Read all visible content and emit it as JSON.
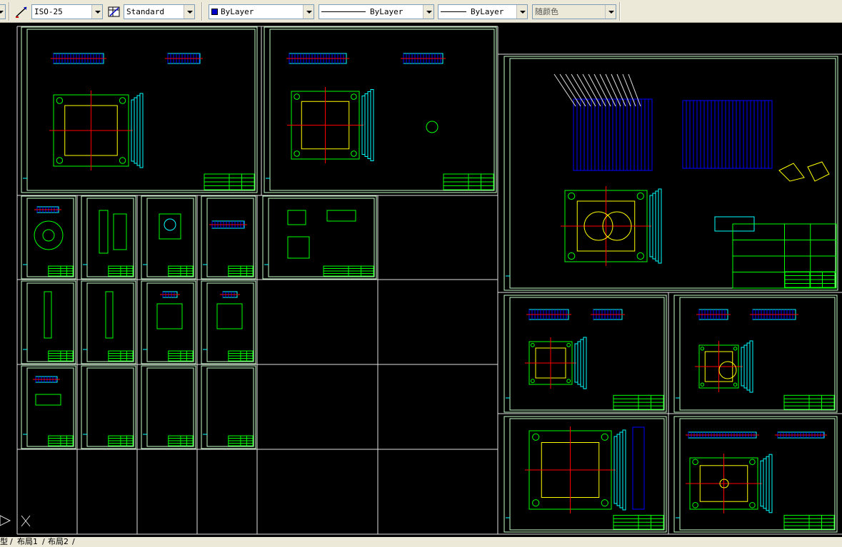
{
  "toolbar": {
    "dimstyle": "ISO-25",
    "tablestyle": "Standard",
    "color": "ByLayer",
    "linetype": "ByLayer",
    "lineweight": "ByLayer",
    "plotstyle": "随颜色"
  },
  "tabs": {
    "model": "型",
    "layout1": "布局1",
    "layout2": "布局2"
  },
  "colors": {
    "frame": "#c8ffc8",
    "grid": "#e0e0e0",
    "entity_green": "#00ff00",
    "entity_cyan": "#00ffff",
    "entity_blue": "#0000ff",
    "entity_yellow": "#ffff00",
    "entity_red": "#ff0000",
    "entity_magenta": "#ff00ff"
  },
  "ucs_icon": "ucs-icon"
}
